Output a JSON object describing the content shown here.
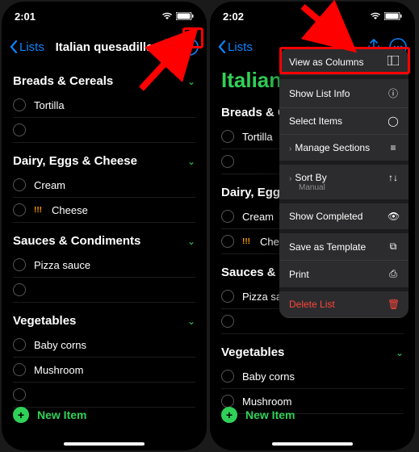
{
  "left": {
    "time": "2:01",
    "back_label": "Lists",
    "title": "Italian quesadilla",
    "sections": {
      "breads": {
        "title": "Breads & Cereals",
        "items": [
          "Tortilla"
        ]
      },
      "dairy": {
        "title": "Dairy, Eggs & Cheese",
        "items": [
          "Cream",
          "Cheese"
        ]
      },
      "sauces": {
        "title": "Sauces & Condiments",
        "items": [
          "Pizza sauce"
        ]
      },
      "veg": {
        "title": "Vegetables",
        "items": [
          "Baby corns",
          "Mushroom"
        ]
      }
    },
    "new_item": "New Item"
  },
  "right": {
    "time": "2:02",
    "back_label": "Lists",
    "large_title": "Italian q",
    "sections": {
      "breads": {
        "title": "Breads & Ce",
        "items": [
          "Tortilla"
        ]
      },
      "dairy": {
        "title": "Dairy, Eggs",
        "items": [
          "Cream",
          "Cheese"
        ]
      },
      "sauces": {
        "title": "Sauces & Condiments",
        "items": [
          "Pizza sauce"
        ]
      },
      "veg": {
        "title": "Vegetables",
        "items": [
          "Baby corns",
          "Mushroom"
        ]
      }
    },
    "new_item": "New Item",
    "menu": {
      "view_columns": "View as Columns",
      "show_info": "Show List Info",
      "select_items": "Select Items",
      "manage_sections": "Manage Sections",
      "sort_by": "Sort By",
      "sort_value": "Manual",
      "show_completed": "Show Completed",
      "save_template": "Save as Template",
      "print": "Print",
      "delete": "Delete List"
    }
  }
}
